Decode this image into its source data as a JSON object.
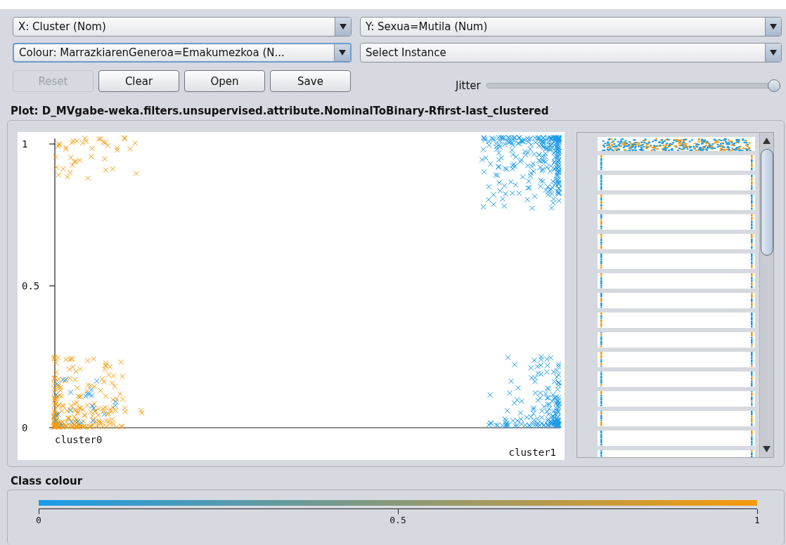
{
  "selectors": [
    {
      "value": "X: Cluster (Nom)",
      "focused": false
    },
    {
      "value": "Y: Sexua=Mutila (Num)",
      "focused": false
    },
    {
      "value": "Colour: MarrazkiarenGeneroa=Emakumezkoa (N...",
      "focused": true
    },
    {
      "value": "Select Instance",
      "focused": false
    }
  ],
  "buttons": [
    {
      "label": "Reset",
      "disabled": true
    },
    {
      "label": "Clear",
      "disabled": false
    },
    {
      "label": "Open",
      "disabled": false
    },
    {
      "label": "Save",
      "disabled": false
    }
  ],
  "jitter": {
    "label": "Jitter",
    "level": 1
  },
  "plot": {
    "title": "Plot: D_MVgabe-weka.filters.unsupervised.attribute.NominalToBinary-Rfirst-last_clustered",
    "y_ticks": [
      "1",
      "0.5",
      "0"
    ],
    "x_categories": [
      "cluster0",
      "cluster1"
    ]
  },
  "class_colour": {
    "title": "Class colour",
    "ticks": [
      "0",
      "0.5",
      "1"
    ]
  }
}
